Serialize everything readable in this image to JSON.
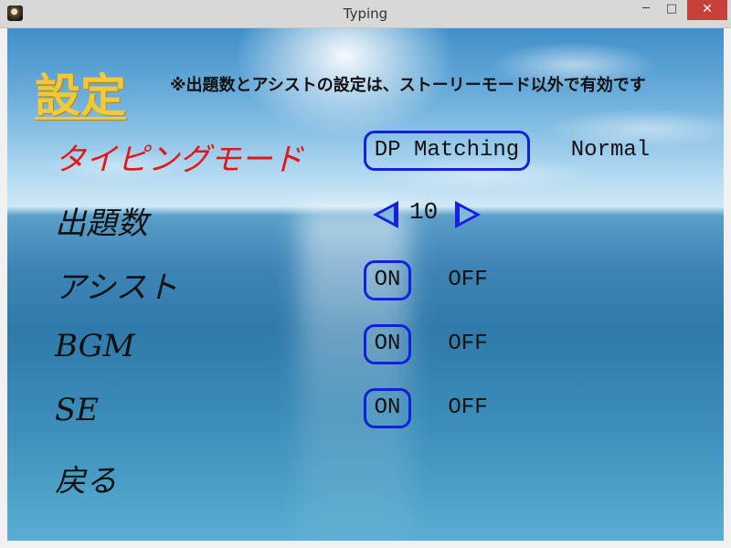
{
  "window": {
    "title": "Typing",
    "minimize": "─",
    "maximize": "□",
    "close": "✕"
  },
  "heading": "設定",
  "note": "※出題数とアシストの設定は、ストーリーモード以外で有効です",
  "settings": {
    "typing_mode": {
      "label": "タイピングモード",
      "options": [
        "DP Matching",
        "Normal"
      ],
      "selected": "DP Matching"
    },
    "question_count": {
      "label": "出題数",
      "value": "10"
    },
    "assist": {
      "label": "アシスト",
      "on": "ON",
      "off": "OFF",
      "selected": "ON"
    },
    "bgm": {
      "label": "BGM",
      "on": "ON",
      "off": "OFF",
      "selected": "ON"
    },
    "se": {
      "label": "SE",
      "on": "ON",
      "off": "OFF",
      "selected": "ON"
    },
    "back": {
      "label": "戻る"
    }
  },
  "colors": {
    "heading": "#f3c93a",
    "active_label": "#e01818",
    "selection_border": "#1420e0",
    "arrows": "#1620e0"
  },
  "icons": {
    "app": "typing-app-icon",
    "decrement": "triangle-left-icon",
    "increment": "triangle-right-icon"
  }
}
